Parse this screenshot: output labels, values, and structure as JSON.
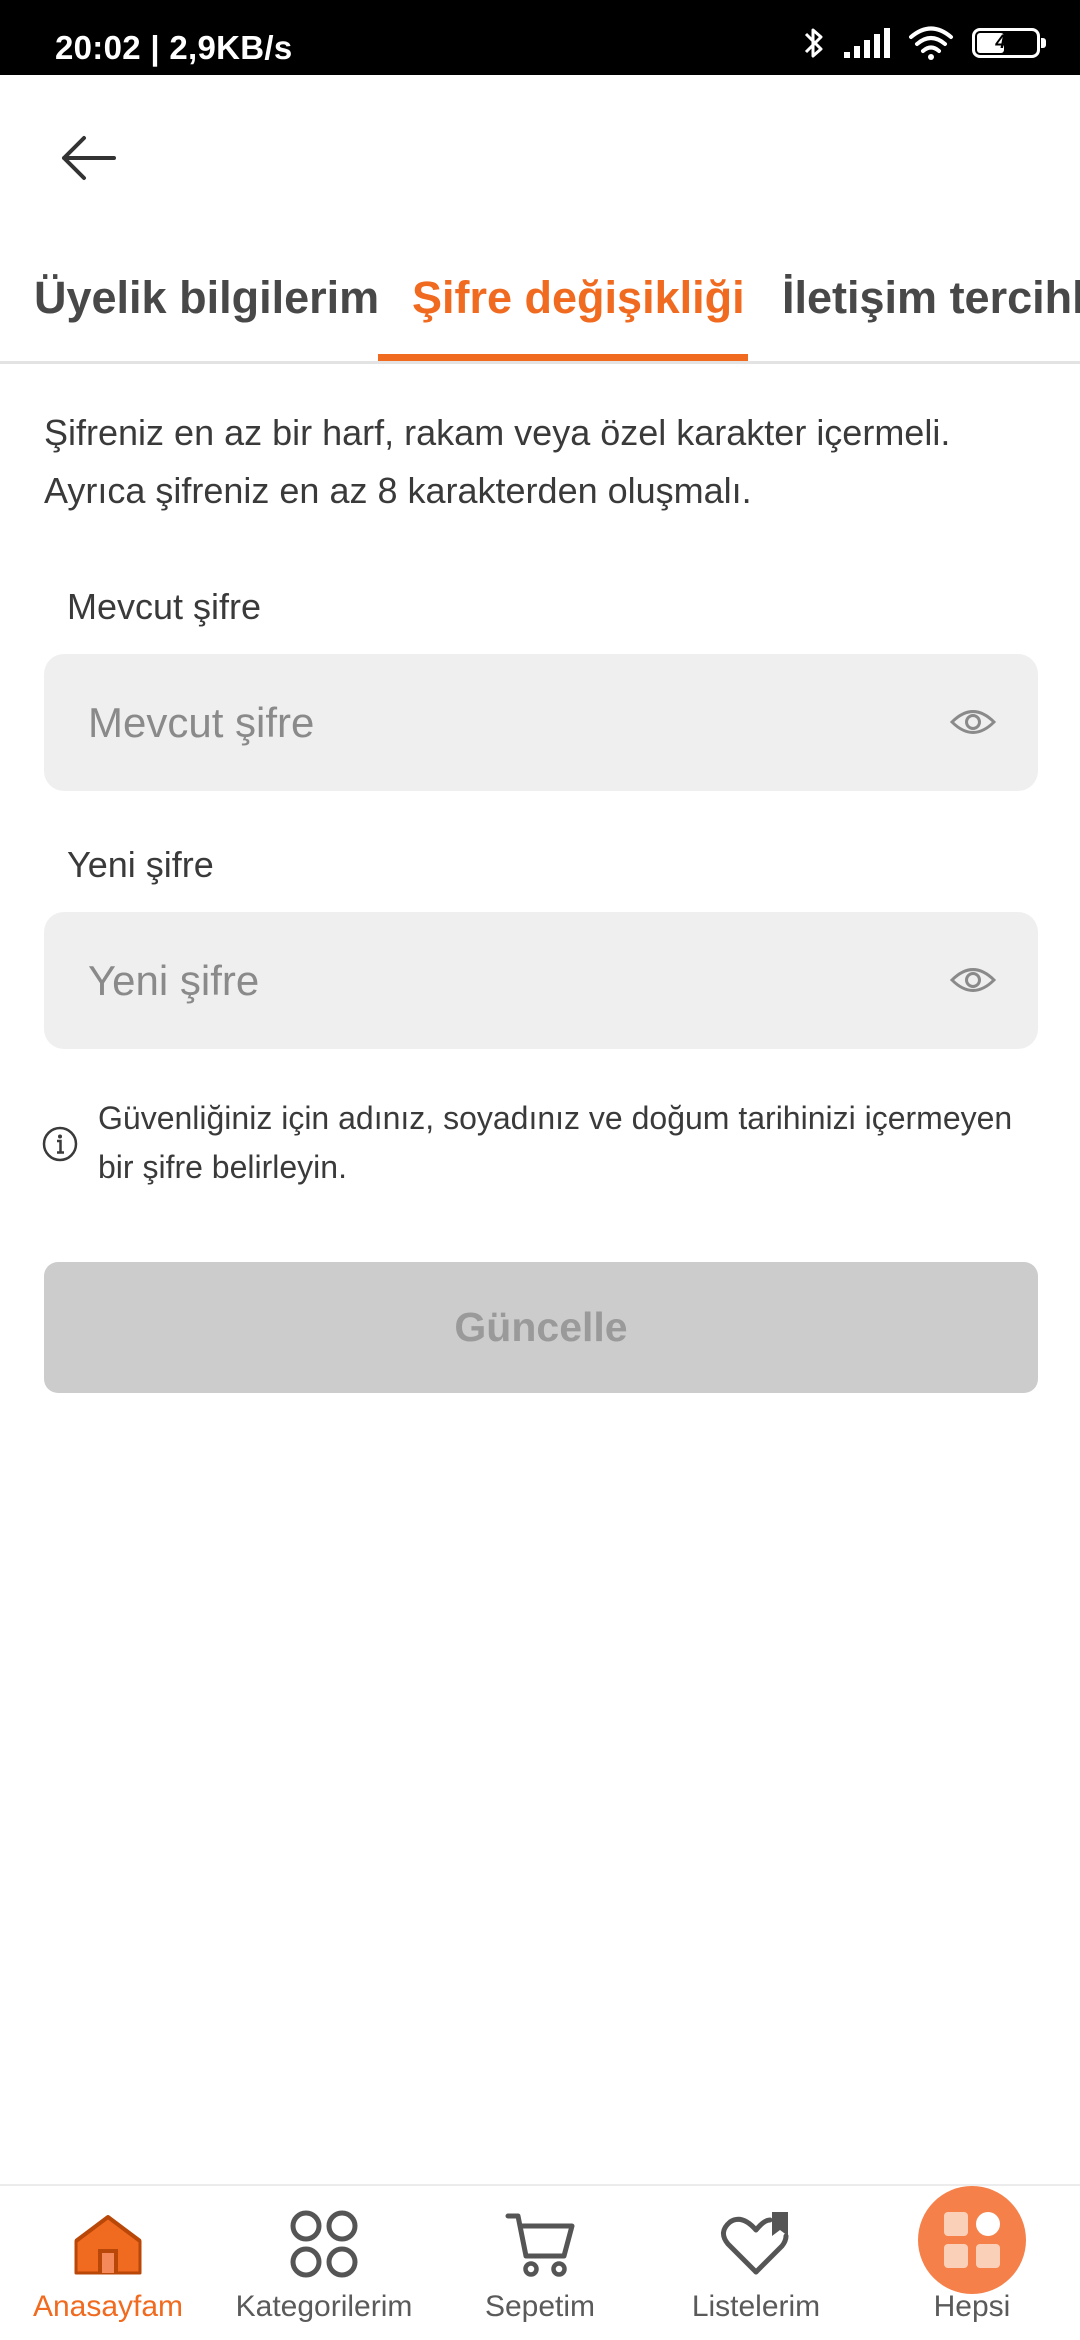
{
  "status_bar": {
    "time": "20:02 | 2,9KB/s",
    "battery": "46",
    "battery_level": 0.46
  },
  "header": {
    "back_icon": "arrow-left-icon"
  },
  "tabs": [
    {
      "label": "Üyelik bilgilerim",
      "active": false
    },
    {
      "label": "Şifre değişikliği",
      "active": true
    },
    {
      "label": "İletişim tercihle",
      "active": false
    }
  ],
  "form": {
    "info_line1": "Şifreniz en az bir harf, rakam veya özel karakter içermeli.",
    "info_line2": "Ayrıca şifreniz en az 8 karakterden oluşmalı.",
    "current_password": {
      "label": "Mevcut şifre",
      "placeholder": "Mevcut şifre",
      "value": ""
    },
    "new_password": {
      "label": "Yeni şifre",
      "placeholder": "Yeni şifre",
      "value": ""
    },
    "hint_line1": "Güvenliğiniz için adınız, soyadınız ve doğum tarihinizi içermeyen",
    "hint_line2": "bir şifre belirleyin.",
    "submit_label": "Güncelle"
  },
  "bottom_nav": [
    {
      "label": "Anasayfam",
      "icon": "home-icon",
      "active": true
    },
    {
      "label": "Kategorilerim",
      "icon": "categories-icon",
      "active": false
    },
    {
      "label": "Sepetim",
      "icon": "cart-icon",
      "active": false
    },
    {
      "label": "Listelerim",
      "icon": "heart-list-icon",
      "active": false
    },
    {
      "label": "Hepsi",
      "icon": "apps-grid-icon",
      "active": false
    }
  ],
  "colors": {
    "accent": "#f06a1f",
    "input_bg": "#efefef",
    "disabled_button": "#cccccc"
  }
}
